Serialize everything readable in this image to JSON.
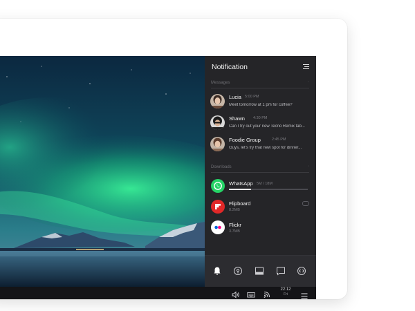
{
  "notification_panel": {
    "title": "Notification",
    "messages_section": {
      "title": "Messages",
      "items": [
        {
          "name": "Lucia",
          "time": "5:00 PM",
          "text": "Meet tomorrow at 1 pm for coffee?"
        },
        {
          "name": "Shawn",
          "time": "4:30 PM",
          "text": "Can I try out your new Tecno Remix tab..."
        },
        {
          "name": "Foodie Group",
          "time": "2:45 PM",
          "text": "Guys, let's try that new spot for dinner..."
        }
      ]
    },
    "downloads_section": {
      "title": "Downloads",
      "items": [
        {
          "name": "WhatsApp",
          "status": "5M / 18M",
          "progress": 0.28
        },
        {
          "name": "Flipboard",
          "status": "8.2MB"
        },
        {
          "name": "Flickr",
          "status": "3.7MB"
        }
      ]
    },
    "bottom_icons": [
      "bell-icon",
      "location-icon",
      "tablet-icon",
      "chat-bubble-icon",
      "code-icon"
    ]
  },
  "taskbar": {
    "clock_time": "22:12",
    "clock_day": "Fri",
    "icons": [
      "volume-icon",
      "keyboard-icon",
      "wifi-icon",
      "menu-icon"
    ]
  },
  "colors": {
    "panel_bg": "#252528",
    "taskbar_bg": "#141417",
    "whatsapp": "#25d366",
    "flipboard": "#e12828",
    "flickr_blue": "#0063dc",
    "flickr_pink": "#ff0084"
  }
}
